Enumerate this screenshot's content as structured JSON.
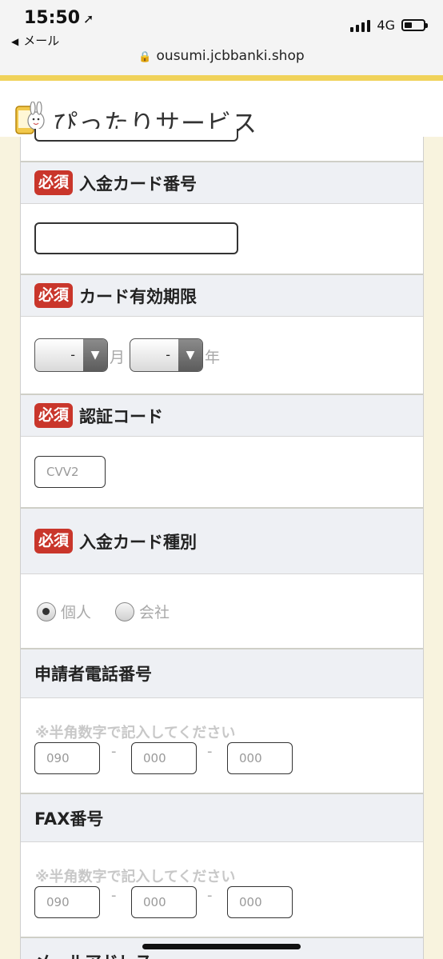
{
  "status_bar": {
    "time": "15:50",
    "back_label": "メール",
    "network": "4G",
    "url": "ousumi.jcbbanki.shop"
  },
  "header": {
    "title": "ぴったりサービス",
    "logo_icon": "smartphone-rabbit-mascot-icon"
  },
  "badges": {
    "required": "必須"
  },
  "form": {
    "card_number": {
      "label": "入金カード番号",
      "value": "",
      "placeholder": ""
    },
    "expiry": {
      "label": "カード有効期限",
      "month_value": "-",
      "month_unit": "月",
      "year_value": "-",
      "year_unit": "年"
    },
    "cvv": {
      "label": "認証コード",
      "placeholder": "CVV2"
    },
    "card_type": {
      "label": "入金カード種別",
      "options": [
        {
          "label": "個人",
          "selected": true
        },
        {
          "label": "会社",
          "selected": false
        }
      ]
    },
    "phone": {
      "label": "申請者電話番号",
      "hint": "※半角数字で記入してください",
      "placeholders": [
        "090",
        "000",
        "000"
      ],
      "separator": "-"
    },
    "fax": {
      "label": "FAX番号",
      "hint": "※半角数字で記入してください",
      "placeholders": [
        "090",
        "000",
        "000"
      ],
      "separator": "-"
    },
    "email": {
      "label": "メールアドレス"
    }
  },
  "colors": {
    "required_badge": "#c9362b",
    "section_header_bg": "#eef0f4",
    "page_bg": "#f8f3de",
    "accent_line": "#f0d25a"
  }
}
